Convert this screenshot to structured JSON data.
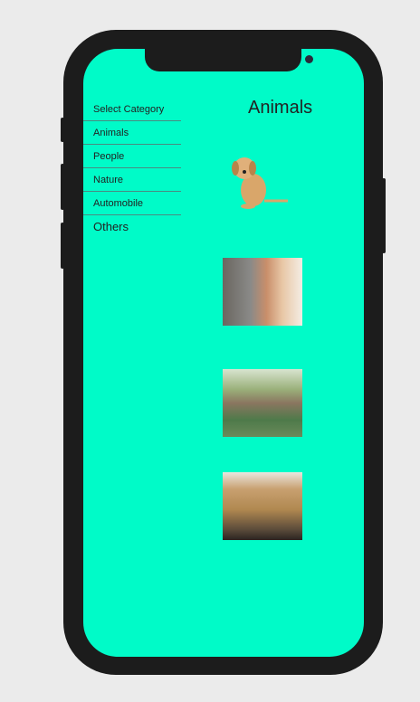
{
  "menu": {
    "items": [
      {
        "label": "Select Category"
      },
      {
        "label": "Animals"
      },
      {
        "label": "People"
      },
      {
        "label": "Nature"
      },
      {
        "label": "Automobile"
      },
      {
        "label": "Others"
      }
    ]
  },
  "content": {
    "title": "Animals",
    "images": [
      {
        "subject": "puppy"
      },
      {
        "subject": "woman-with-cat"
      },
      {
        "subject": "children-at-zoo"
      },
      {
        "subject": "safari-photographer"
      }
    ]
  },
  "colors": {
    "screen": "#00fbc8",
    "frame": "#1c1c1c",
    "background": "#ebebeb"
  }
}
